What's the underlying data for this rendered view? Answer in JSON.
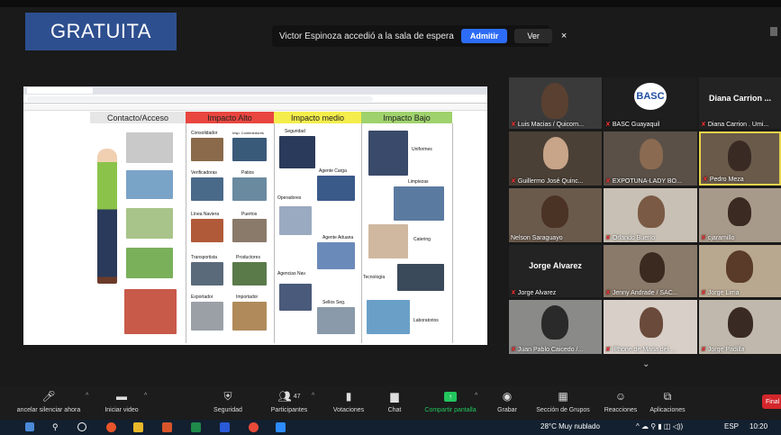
{
  "badge": {
    "text": "GRATUITA"
  },
  "notification": {
    "message": "Victor Espinoza accedió a la sala de espera",
    "admit_label": "Admitir",
    "view_label": "Ver",
    "close_glyph": "×"
  },
  "shared_screen": {
    "headers": [
      "Contacto/Acceso",
      "Impacto Alto",
      "Impacto medio",
      "Impacto Bajo"
    ],
    "high_impact_labels": [
      "Consolidador",
      "Insp. Contenedores",
      "Verificadoras",
      "Patios",
      "Línea Naviera",
      "Puertos",
      "Transportista",
      "Productores",
      "Exportador",
      "Importador"
    ],
    "medium_impact_labels": [
      "Seguridad",
      "Agente Carga",
      "Operadores",
      "Agente Aduana",
      "Agencias Nav.",
      "Sellos Seg."
    ],
    "low_impact_labels": [
      "Uniformes",
      "Limpiezas",
      "Catering",
      "Tecnología",
      "Laboratorios"
    ]
  },
  "participants": [
    {
      "name": "Luis Macias / Quicorn..."
    },
    {
      "name": "BASC Guayaquil",
      "logo": "BASC"
    },
    {
      "name": "Diana Carrion . Umi...",
      "display": "Diana Carrion ..."
    },
    {
      "name": "Guillermo José Quinc..."
    },
    {
      "name": "EXPOTUNA-LADY BO..."
    },
    {
      "name": "Pedro Meza"
    },
    {
      "name": "Nelson Saraguayo"
    },
    {
      "name": "Orlando Bueno"
    },
    {
      "name": "cjaramillo"
    },
    {
      "name": "Jorge Alvarez",
      "display": "Jorge Alvarez"
    },
    {
      "name": "Jenny Andrade / SAC..."
    },
    {
      "name": "Jorge Lima"
    },
    {
      "name": "Juan Pablo Caicedo /..."
    },
    {
      "name": "iPhone de Maria del ..."
    },
    {
      "name": "Jorge Padilla"
    }
  ],
  "toolbar": {
    "mute": "ancelar silenciar ahora",
    "video": "Iniciar video",
    "security": "Seguridad",
    "participants": "Participantes",
    "participants_count": "47",
    "polls": "Votaciones",
    "chat": "Chat",
    "share": "Compartir pantalla",
    "record": "Grabar",
    "groups": "Sección de Grupos",
    "reactions": "Reacciones",
    "apps": "Aplicaciones",
    "end": "Final"
  },
  "taskbar": {
    "weather": "28°C  Muy nublado",
    "lang": "ESP",
    "time": "10:20"
  },
  "colors": {
    "badge_bg": "#2e4f8f",
    "admit_bg": "#2d6cf6",
    "share_green": "#22c55e",
    "high": "#e8463f",
    "medium": "#f4ed4b",
    "low": "#9fd26d"
  }
}
